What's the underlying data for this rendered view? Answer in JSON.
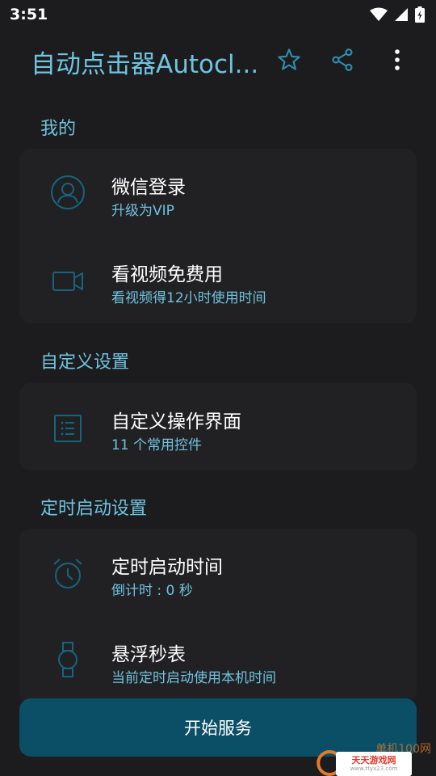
{
  "status_bar": {
    "time": "3:51"
  },
  "app_bar": {
    "title": "自动点击器Autocl..."
  },
  "sections": [
    {
      "title": "我的",
      "items": [
        {
          "title": "微信登录",
          "subtitle": "升级为VIP",
          "icon": "user-icon"
        },
        {
          "title": "看视频免费用",
          "subtitle": "看视频得12小时使用时间",
          "icon": "video-camera-icon"
        }
      ]
    },
    {
      "title": "自定义设置",
      "items": [
        {
          "title": "自定义操作界面",
          "subtitle": "11 个常用控件",
          "icon": "list-icon"
        }
      ]
    },
    {
      "title": "定时启动设置",
      "items": [
        {
          "title": "定时启动时间",
          "subtitle": "倒计时 : 0 秒",
          "icon": "alarm-clock-icon"
        },
        {
          "title": "悬浮秒表",
          "subtitle": "当前定时启动使用本机时间",
          "icon": "watch-icon"
        }
      ]
    }
  ],
  "start_button": {
    "label": "开始服务"
  },
  "watermark": {
    "top_text": "单机100网",
    "box_main": "天天游戏网",
    "box_url": "www.ttyx23.com"
  },
  "colors": {
    "accent": "#6fc3df",
    "background": "#1c1c1e",
    "card": "#212123",
    "button": "#0b4f66"
  }
}
